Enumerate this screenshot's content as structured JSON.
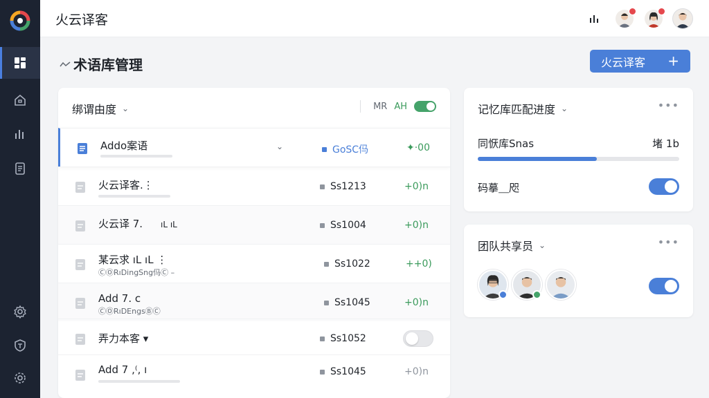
{
  "app": {
    "title": "火云译客"
  },
  "page": {
    "title": "术语库管理",
    "primary_button": "火云译客"
  },
  "term_panel": {
    "filter_label": "绑谓由度",
    "mr_label": "MR",
    "ah_label": "AH",
    "rows": [
      {
        "name": "Addo案语",
        "sub": "",
        "code": "GoSC㐷",
        "score": "✦·00",
        "selected": true
      },
      {
        "name": "火云译客.⋮",
        "sub": "",
        "code": "Ss1213",
        "score": "+0)n"
      },
      {
        "name": "火云译 7.",
        "sub": "",
        "code": "Ss1004",
        "score": "+0)n",
        "marks": "ıL ıL"
      },
      {
        "name": "某云求 ıL ıL ⋮",
        "sub": "ⒸⓄRıDingSng㐷Ⓒ –",
        "code": "Ss1022",
        "score": "++0)"
      },
      {
        "name": "Add 7. c",
        "sub": "ⒸⓄRıDEngsⒷⒸ",
        "code": "Ss1045",
        "score": "+0)n"
      },
      {
        "name": "弄力本客 ▾",
        "sub": "",
        "code": "Ss1052",
        "score": ""
      },
      {
        "name": "Add 7 ,⁽, ı",
        "sub": "",
        "code": "Ss1045",
        "score": "+0)n"
      }
    ]
  },
  "memory_panel": {
    "title": "记忆库匹配进度",
    "label": "同恹库Snas",
    "value": "堵 1b",
    "progress": 0.59,
    "label2": "码摹⸏咫",
    "toggle_on": true
  },
  "team_panel": {
    "title": "团队共享员",
    "members": [
      {
        "name": "member-1",
        "status_color": "#4a7fd8"
      },
      {
        "name": "member-2",
        "status_color": "#45a36a"
      },
      {
        "name": "member-3",
        "status_color": ""
      }
    ],
    "toggle_on": true
  },
  "colors": {
    "accent": "#4a7fd8",
    "success": "#45a36a",
    "sidebar": "#1c2331"
  }
}
